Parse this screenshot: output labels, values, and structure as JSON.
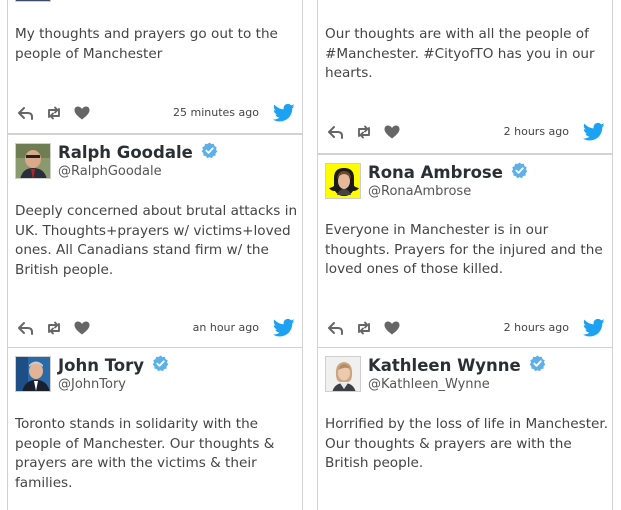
{
  "tweets": [
    {
      "text": "My thoughts and prayers go out to the people of Manchester",
      "time": "25 minutes ago"
    },
    {
      "text": "Our thoughts are with all the people of #Manchester. #CityofTO has you in our hearts.",
      "time": "2 hours ago"
    },
    {
      "name": "Ralph Goodale",
      "handle": "@RalphGoodale",
      "text": "Deeply concerned about brutal attacks in UK. Thoughts+prayers w/ victims+loved ones. All Canadians stand firm w/ the British people.",
      "time": "an hour ago"
    },
    {
      "name": "Rona Ambrose",
      "handle": "@RonaAmbrose",
      "text": "Everyone in Manchester is in our thoughts. Prayers for the injured and the loved ones of those killed.",
      "time": "2 hours ago"
    },
    {
      "name": "John Tory",
      "handle": "@JohnTory",
      "text": "Toronto stands in solidarity with the people of Manchester. Our thoughts & prayers are with the victims & their families."
    },
    {
      "name": "Kathleen Wynne",
      "handle": "@Kathleen_Wynne",
      "text": "Horrified by the loss of life in Manchester. Our thoughts & prayers are with the British people."
    }
  ],
  "colors": {
    "twitter_blue": "#1da1f2",
    "verified_blue": "#5db1e8",
    "action_gray": "#666666",
    "border": "#d2d2d2"
  },
  "icons": [
    "reply-icon",
    "retweet-icon",
    "like-icon",
    "twitter-bird-icon",
    "verified-badge-icon"
  ]
}
